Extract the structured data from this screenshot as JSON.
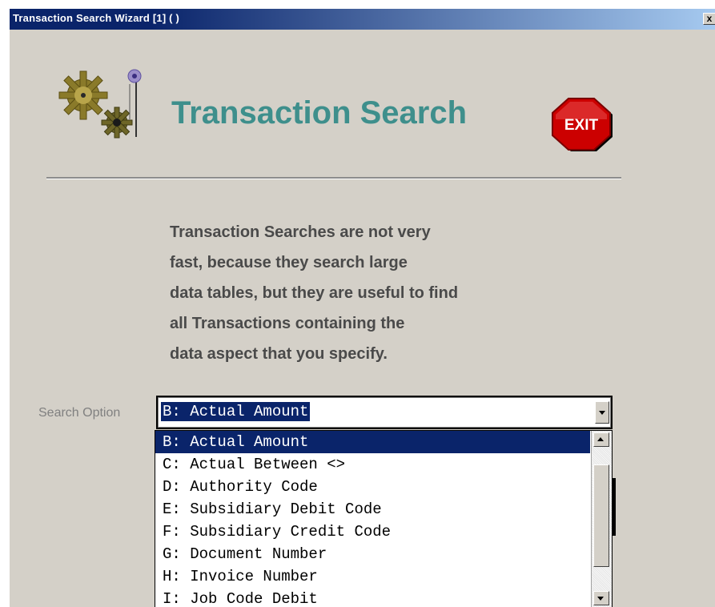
{
  "window": {
    "title": "Transaction Search Wizard [1]   ( )",
    "close_label": "x"
  },
  "header": {
    "title": "Transaction Search",
    "logo_icon": "gears-icon",
    "exit_label": "EXIT",
    "accent_color": "#3e8f8c",
    "exit_color": "#cc0000"
  },
  "description": {
    "lines": [
      "Transaction Searches are not very",
      "fast, because they search large",
      "data tables, but they are useful to find",
      "all Transactions containing the",
      "data aspect that you specify."
    ]
  },
  "search": {
    "label": "Search Option",
    "selected_value": "B: Actual Amount",
    "options": [
      "B: Actual Amount",
      "C: Actual Between <>",
      "D: Authority Code",
      "E: Subsidiary Debit Code",
      "F: Subsidiary Credit Code",
      "G: Document Number",
      "H: Invoice Number",
      "I: Job Code Debit"
    ]
  }
}
